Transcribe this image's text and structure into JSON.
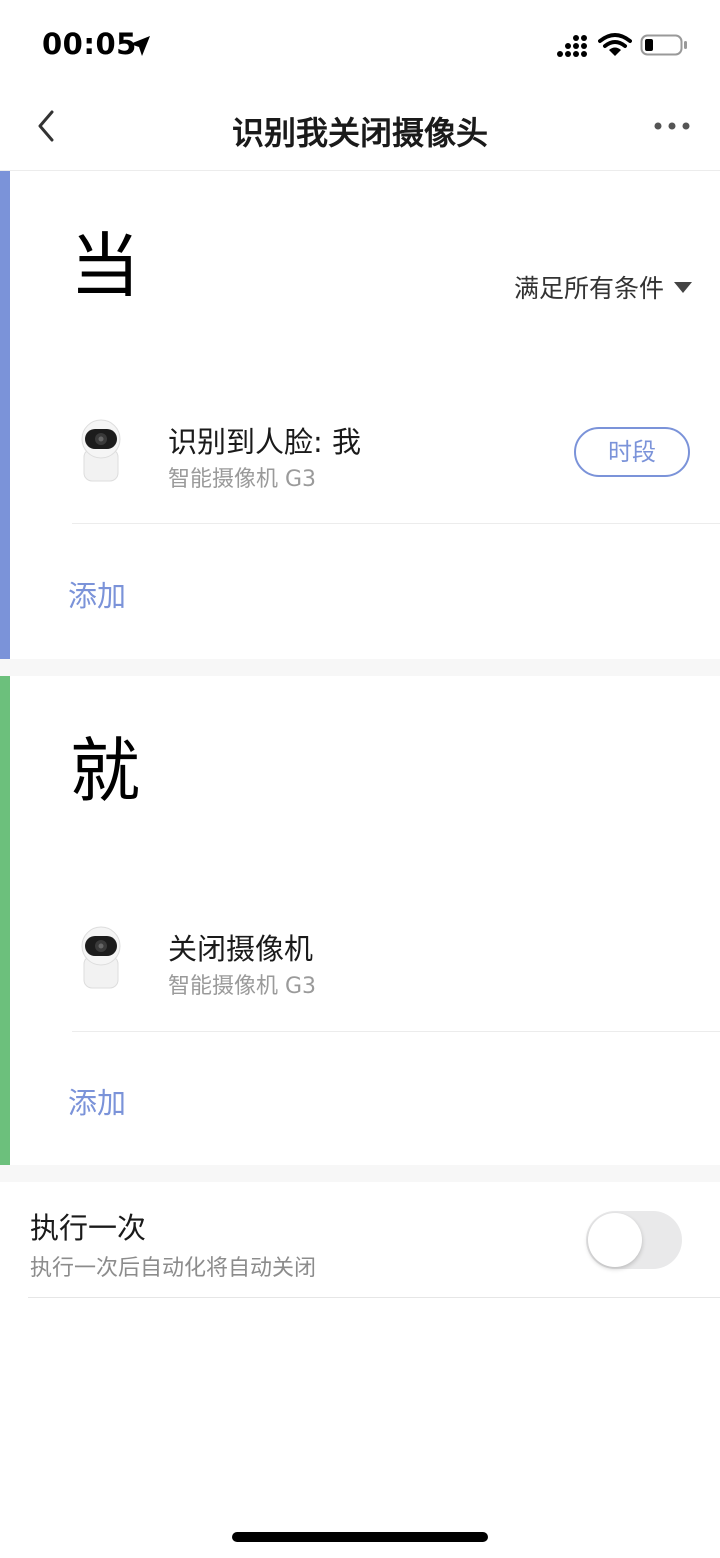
{
  "status_bar": {
    "time": "00:05"
  },
  "nav": {
    "title": "识别我关闭摄像头"
  },
  "when_section": {
    "heading": "当",
    "condition_mode": "满足所有条件",
    "accent_color": "#7b93d9",
    "items": [
      {
        "title": "识别到人脸: 我",
        "device": "智能摄像机 G3",
        "period_label": "时段"
      }
    ],
    "add_label": "添加"
  },
  "then_section": {
    "heading": "就",
    "accent_color": "#6cc07c",
    "items": [
      {
        "title": "关闭摄像机",
        "device": "智能摄像机 G3"
      }
    ],
    "add_label": "添加"
  },
  "run_once": {
    "title": "执行一次",
    "subtitle": "执行一次后自动化将自动关闭",
    "enabled": false
  }
}
